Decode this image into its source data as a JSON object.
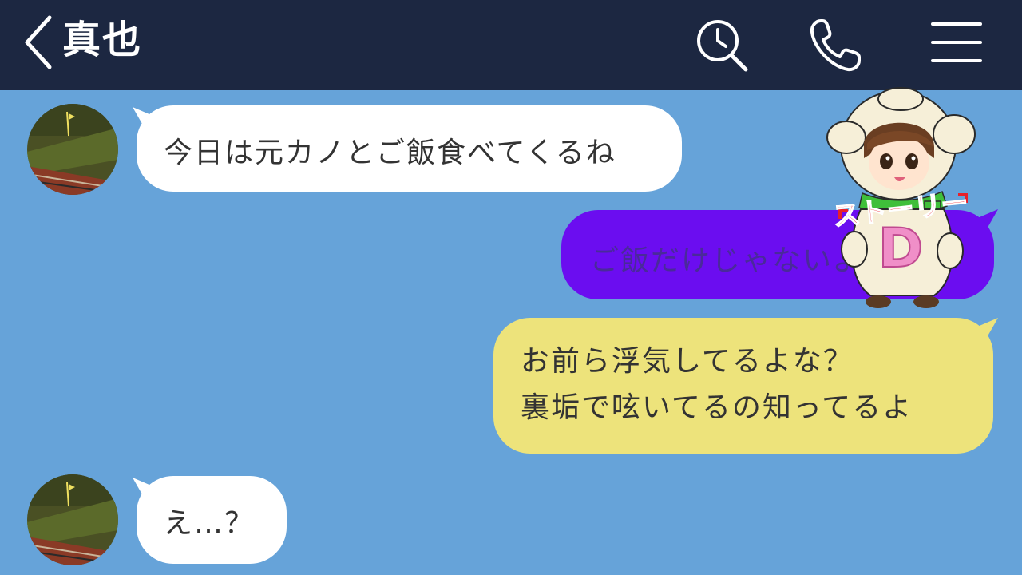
{
  "header": {
    "contact_name": "真也",
    "icons": [
      "back-chevron-icon",
      "search-history-icon",
      "phone-icon",
      "menu-icon"
    ]
  },
  "messages": [
    {
      "side": "incoming",
      "text": "今日は元カノとご飯食べてくるね"
    },
    {
      "side": "outgoing",
      "text": "ご飯だけじゃないよね？"
    },
    {
      "side": "outgoing",
      "lines": [
        "お前ら浮気してるよな？",
        "裏垢で呟いてるの知ってるよ"
      ]
    },
    {
      "side": "incoming",
      "text": "え…？"
    }
  ],
  "overlay": {
    "mascot_text": "ストーリー",
    "mascot_letter": "D"
  },
  "colors": {
    "header_bg": "#1c2741",
    "chat_bg": "#66a3d9",
    "incoming_bubble": "#ffffff",
    "outgoing_purple": "#6b0df0",
    "outgoing_yellow": "#ede37b"
  }
}
